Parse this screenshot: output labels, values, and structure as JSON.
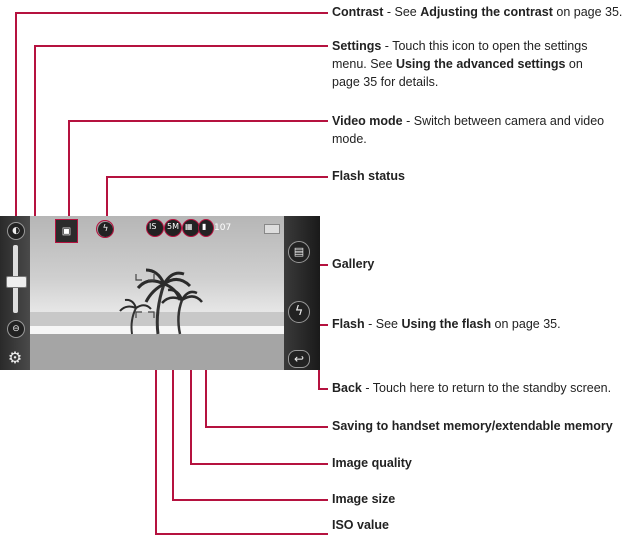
{
  "labels": {
    "contrast": {
      "title": "Contrast",
      "text1": " - See ",
      "link": "Adjusting the contrast",
      "text2": " on page 35."
    },
    "settings": {
      "title": "Settings",
      "text1": " - Touch this icon to open the settings",
      "line2": "menu. See ",
      "link": "Using the advanced settings",
      "line2b": " on",
      "line3": "page 35 for details."
    },
    "video_mode": {
      "title": "Video mode",
      "text1": " - Switch between camera and video",
      "line2": "mode."
    },
    "flash_status": {
      "title": "Flash status"
    },
    "gallery": {
      "title": "Gallery"
    },
    "flash": {
      "title": "Flash",
      "text1": " - See ",
      "link": "Using the flash",
      "text2": " on page 35."
    },
    "back": {
      "title": "Back",
      "text1": " - Touch here to return to the standby screen."
    },
    "saving": {
      "title": "Saving to handset memory/extendable memory"
    },
    "image_quality": {
      "title": "Image quality"
    },
    "image_size": {
      "title": "Image size"
    },
    "iso_value": {
      "title": "ISO value"
    }
  },
  "screen": {
    "shots_remaining": "107",
    "icons": [
      "contrast-icon",
      "settings-icon",
      "video-mode-icon",
      "flash-status-icon",
      "iso-icon",
      "image-size-icon",
      "image-quality-icon",
      "memory-icon",
      "battery-icon",
      "gallery-icon",
      "flash-icon",
      "back-icon"
    ]
  },
  "colors": {
    "accent": "#b5123f"
  }
}
